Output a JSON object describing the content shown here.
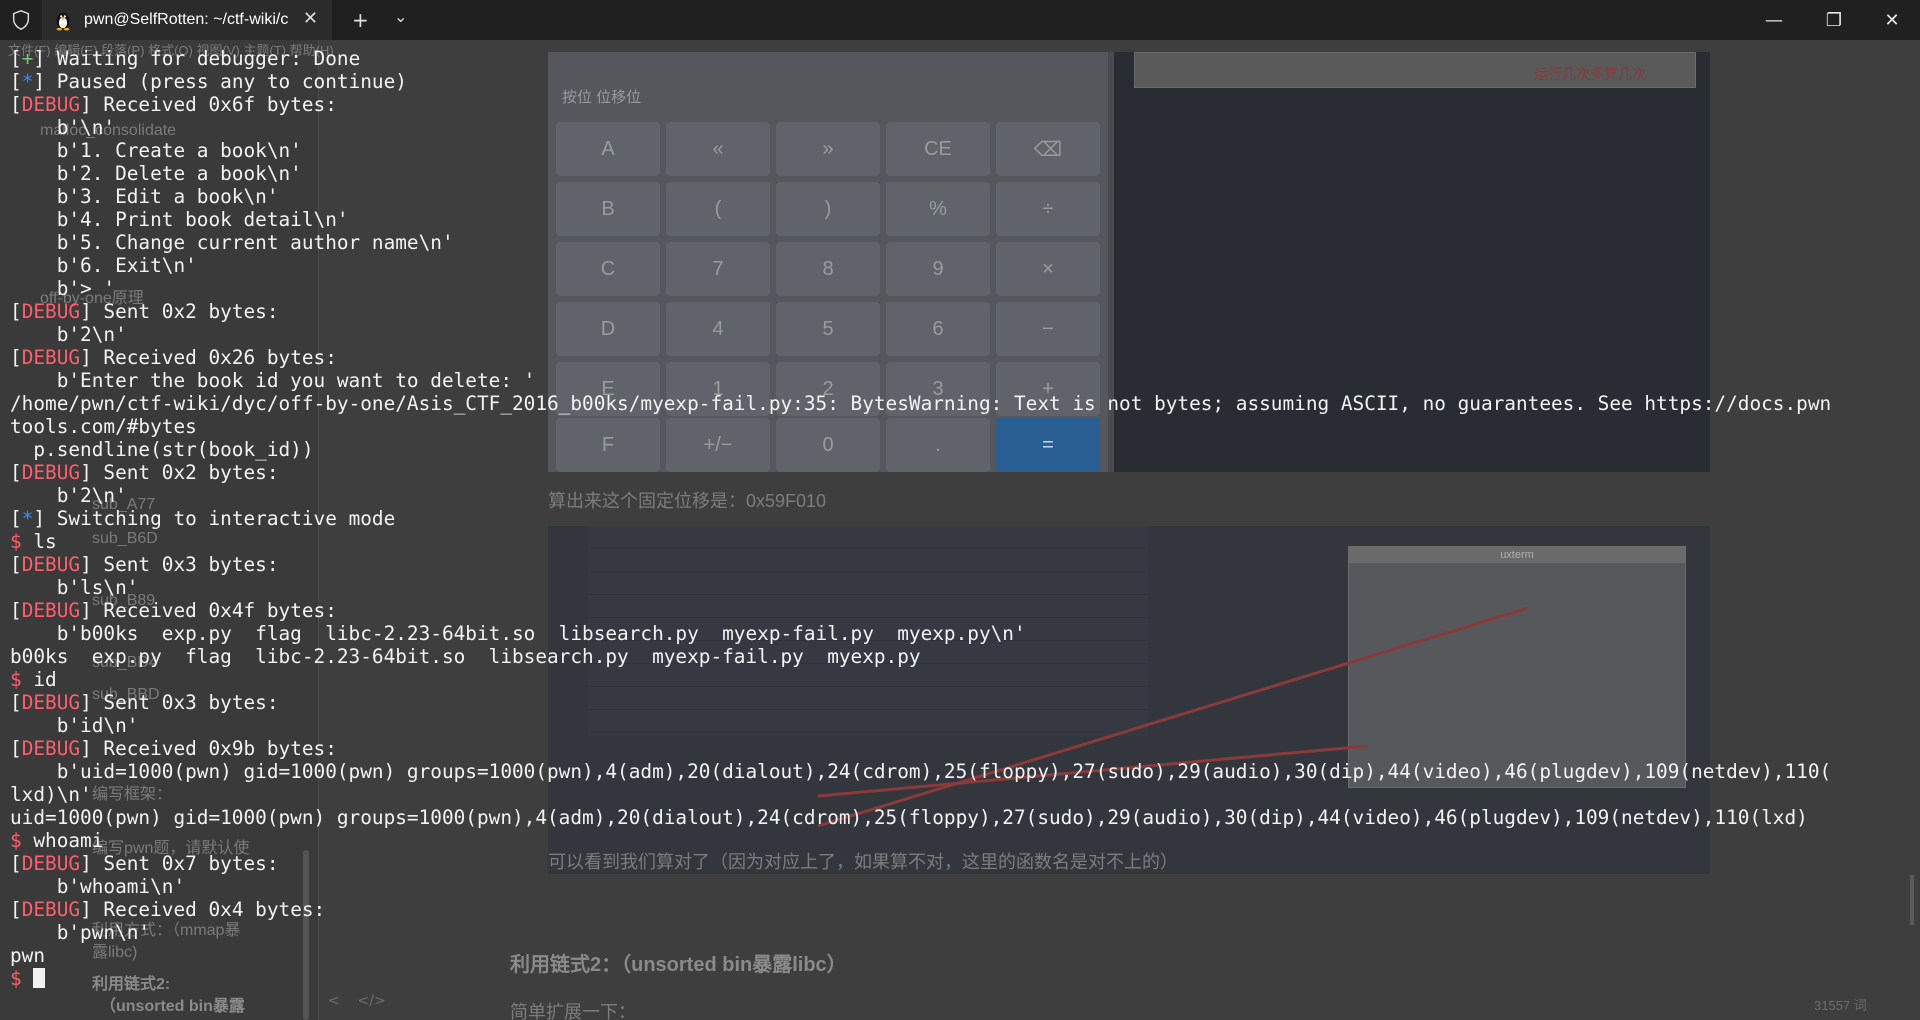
{
  "window": {
    "tab_title": "pwn@SelfRotten: ~/ctf-wiki/c",
    "new_tab_label": "+",
    "dropdown_label": "⌄",
    "close_tab_label": "✕",
    "minimize_label": "—",
    "restore_label": "❐",
    "close_label": "✕"
  },
  "background_doc": {
    "sidebar_items": [
      "文件(F)  编辑(E)  段落(P)  格式(O)  视图(V)  主题(T)  帮助(H)",
      "malloc_consolidate",
      "off-by-one原理",
      "sub_A77",
      "sub_B6D",
      "sub_B89",
      "sub_BD4",
      "sub_BBD",
      "编写框架：",
      "编写pwn题，请默认使",
      "利用方式：（mmap暴",
      "露libc)",
      "利用链式2:",
      "（unsorted bin暴露"
    ],
    "calc_header": "按位   位移位",
    "calc_buttons": [
      "A",
      "«",
      "»",
      "CE",
      "⌫",
      "B",
      "(",
      ")",
      "%",
      "÷",
      "C",
      "7",
      "8",
      "9",
      "×",
      "D",
      "4",
      "5",
      "6",
      "−",
      "E",
      "1",
      "2",
      "3",
      "+",
      "F",
      "+/−",
      "0",
      ".",
      "="
    ],
    "red_note": "运行几次多算几次",
    "caption1": "算出来这个固定位移是：0x59F010",
    "caption2": "可以看到我们算对了（因为对应上了，如果算不对，这里的函数名是对不上的）",
    "heading": "利用链式2：（unsorted bin暴露libc）",
    "small_text": "简单扩展一下：",
    "word_count": "31557 词",
    "uxterm_title": "uxterm"
  },
  "terminal": {
    "lines": [
      [
        {
          "c": "plain",
          "t": "["
        },
        {
          "c": "plus",
          "t": "+"
        },
        {
          "c": "plain",
          "t": "] Waiting for debugger: Done"
        }
      ],
      [
        {
          "c": "plain",
          "t": "["
        },
        {
          "c": "star",
          "t": "*"
        },
        {
          "c": "plain",
          "t": "] Paused (press any to continue)"
        }
      ],
      [
        {
          "c": "plain",
          "t": "["
        },
        {
          "c": "debug",
          "t": "DEBUG"
        },
        {
          "c": "plain",
          "t": "] Received 0x6f bytes:"
        }
      ],
      [
        {
          "c": "plain",
          "t": "    b'\\n'"
        }
      ],
      [
        {
          "c": "plain",
          "t": "    b'1. Create a book\\n'"
        }
      ],
      [
        {
          "c": "plain",
          "t": "    b'2. Delete a book\\n'"
        }
      ],
      [
        {
          "c": "plain",
          "t": "    b'3. Edit a book\\n'"
        }
      ],
      [
        {
          "c": "plain",
          "t": "    b'4. Print book detail\\n'"
        }
      ],
      [
        {
          "c": "plain",
          "t": "    b'5. Change current author name\\n'"
        }
      ],
      [
        {
          "c": "plain",
          "t": "    b'6. Exit\\n'"
        }
      ],
      [
        {
          "c": "plain",
          "t": "    b'> '"
        }
      ],
      [
        {
          "c": "plain",
          "t": "["
        },
        {
          "c": "debug",
          "t": "DEBUG"
        },
        {
          "c": "plain",
          "t": "] Sent 0x2 bytes:"
        }
      ],
      [
        {
          "c": "plain",
          "t": "    b'2\\n'"
        }
      ],
      [
        {
          "c": "plain",
          "t": "["
        },
        {
          "c": "debug",
          "t": "DEBUG"
        },
        {
          "c": "plain",
          "t": "] Received 0x26 bytes:"
        }
      ],
      [
        {
          "c": "plain",
          "t": "    b'Enter the book id you want to delete: '"
        }
      ],
      [
        {
          "c": "plain",
          "t": "/home/pwn/ctf-wiki/dyc/off-by-one/Asis_CTF_2016_b00ks/myexp-fail.py:35: BytesWarning: Text is not bytes; assuming ASCII, no guarantees. See https://docs.pwn"
        }
      ],
      [
        {
          "c": "plain",
          "t": "tools.com/#bytes"
        }
      ],
      [
        {
          "c": "plain",
          "t": "  p.sendline(str(book_id))"
        }
      ],
      [
        {
          "c": "plain",
          "t": "["
        },
        {
          "c": "debug",
          "t": "DEBUG"
        },
        {
          "c": "plain",
          "t": "] Sent 0x2 bytes:"
        }
      ],
      [
        {
          "c": "plain",
          "t": "    b'2\\n'"
        }
      ],
      [
        {
          "c": "plain",
          "t": "["
        },
        {
          "c": "star",
          "t": "*"
        },
        {
          "c": "plain",
          "t": "] Switching to interactive mode"
        }
      ],
      [
        {
          "c": "prompt",
          "t": "$ "
        },
        {
          "c": "plain",
          "t": "ls"
        }
      ],
      [
        {
          "c": "plain",
          "t": "["
        },
        {
          "c": "debug",
          "t": "DEBUG"
        },
        {
          "c": "plain",
          "t": "] Sent 0x3 bytes:"
        }
      ],
      [
        {
          "c": "plain",
          "t": "    b'ls\\n'"
        }
      ],
      [
        {
          "c": "plain",
          "t": "["
        },
        {
          "c": "debug",
          "t": "DEBUG"
        },
        {
          "c": "plain",
          "t": "] Received 0x4f bytes:"
        }
      ],
      [
        {
          "c": "plain",
          "t": "    b'b00ks  exp.py  flag  libc-2.23-64bit.so  libsearch.py  myexp-fail.py  myexp.py\\n'"
        }
      ],
      [
        {
          "c": "plain",
          "t": "b00ks  exp.py  flag  libc-2.23-64bit.so  libsearch.py  myexp-fail.py  myexp.py"
        }
      ],
      [
        {
          "c": "prompt",
          "t": "$ "
        },
        {
          "c": "plain",
          "t": "id"
        }
      ],
      [
        {
          "c": "plain",
          "t": "["
        },
        {
          "c": "debug",
          "t": "DEBUG"
        },
        {
          "c": "plain",
          "t": "] Sent 0x3 bytes:"
        }
      ],
      [
        {
          "c": "plain",
          "t": "    b'id\\n'"
        }
      ],
      [
        {
          "c": "plain",
          "t": "["
        },
        {
          "c": "debug",
          "t": "DEBUG"
        },
        {
          "c": "plain",
          "t": "] Received 0x9b bytes:"
        }
      ],
      [
        {
          "c": "plain",
          "t": "    b'uid=1000(pwn) gid=1000(pwn) groups=1000(pwn),4(adm),20(dialout),24(cdrom),25(floppy),27(sudo),29(audio),30(dip),44(video),46(plugdev),109(netdev),110("
        }
      ],
      [
        {
          "c": "plain",
          "t": "lxd)\\n'"
        }
      ],
      [
        {
          "c": "plain",
          "t": "uid=1000(pwn) gid=1000(pwn) groups=1000(pwn),4(adm),20(dialout),24(cdrom),25(floppy),27(sudo),29(audio),30(dip),44(video),46(plugdev),109(netdev),110(lxd)"
        }
      ],
      [
        {
          "c": "prompt",
          "t": "$ "
        },
        {
          "c": "plain",
          "t": "whoami"
        }
      ],
      [
        {
          "c": "plain",
          "t": "["
        },
        {
          "c": "debug",
          "t": "DEBUG"
        },
        {
          "c": "plain",
          "t": "] Sent 0x7 bytes:"
        }
      ],
      [
        {
          "c": "plain",
          "t": "    b'whoami\\n'"
        }
      ],
      [
        {
          "c": "plain",
          "t": "["
        },
        {
          "c": "debug",
          "t": "DEBUG"
        },
        {
          "c": "plain",
          "t": "] Received 0x4 bytes:"
        }
      ],
      [
        {
          "c": "plain",
          "t": "    b'pwn\\n'"
        }
      ],
      [
        {
          "c": "plain",
          "t": "pwn"
        }
      ],
      [
        {
          "c": "prompt",
          "t": "$ "
        },
        {
          "c": "cursor",
          "t": ""
        }
      ]
    ]
  },
  "colors": {
    "debug": "#ff5f6d",
    "info_star": "#2f8fff",
    "success_plus": "#6fc96f",
    "terminal_text": "#f2f2f2"
  }
}
